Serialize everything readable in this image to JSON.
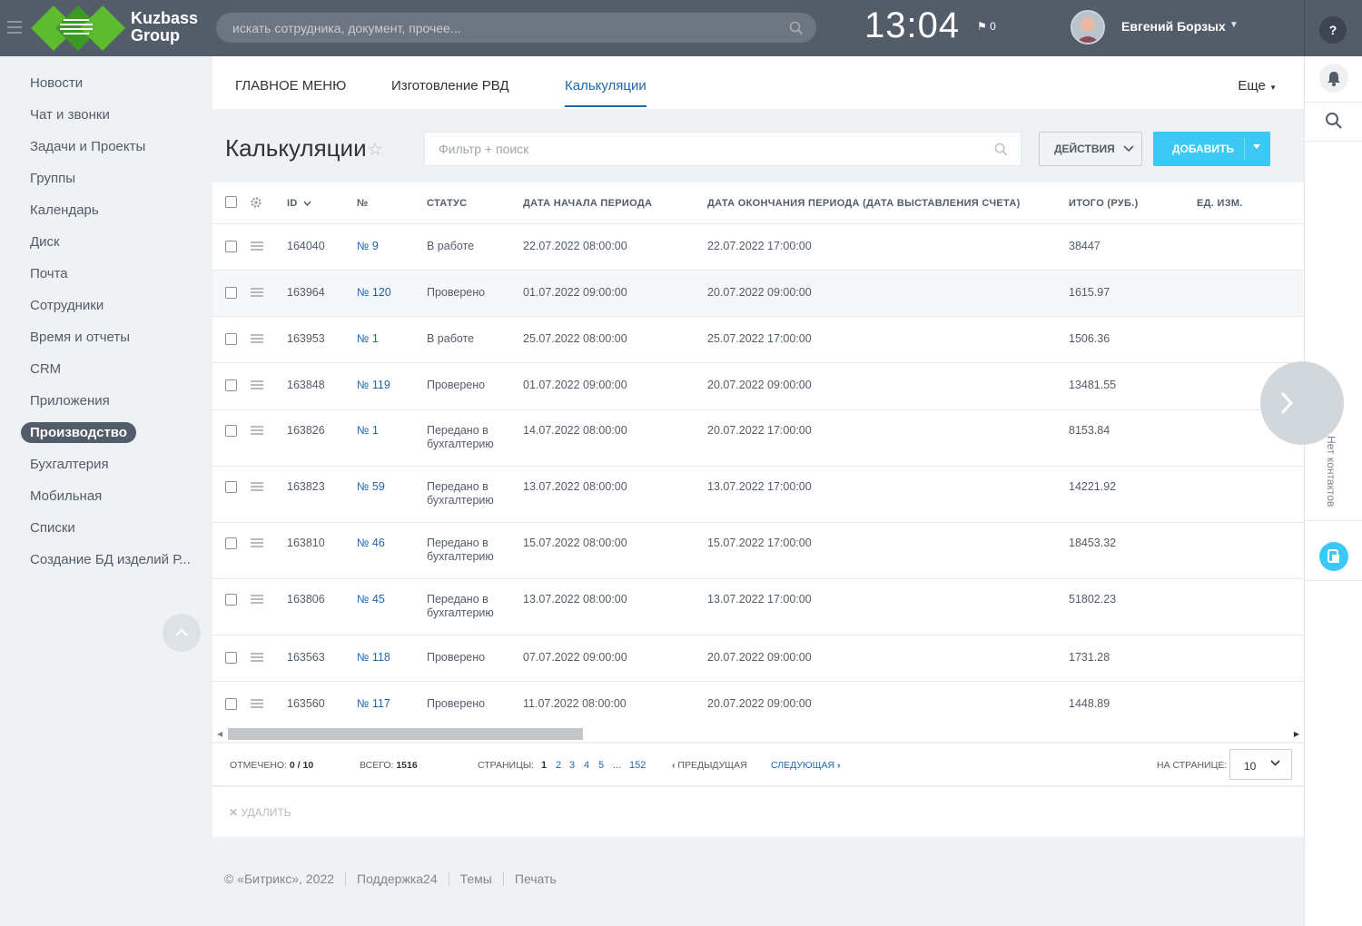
{
  "header": {
    "logo_line1": "Kuzbass",
    "logo_line2": "Group",
    "search_placeholder": "искать сотрудника, документ, прочее...",
    "clock": "13:04",
    "flag_count": "0",
    "user_name": "Евгений Борзых",
    "help_icon": "help-icon"
  },
  "sidebar": {
    "items": [
      {
        "label": "Новости"
      },
      {
        "label": "Чат и звонки"
      },
      {
        "label": "Задачи и Проекты"
      },
      {
        "label": "Группы"
      },
      {
        "label": "Календарь"
      },
      {
        "label": "Диск"
      },
      {
        "label": "Почта"
      },
      {
        "label": "Сотрудники"
      },
      {
        "label": "Время и отчеты"
      },
      {
        "label": "CRM"
      },
      {
        "label": "Приложения"
      },
      {
        "label": "Производство",
        "active": true
      },
      {
        "label": "Бухгалтерия"
      },
      {
        "label": "Мобильная"
      },
      {
        "label": "Списки"
      },
      {
        "label": "Создание БД изделий Р..."
      }
    ]
  },
  "tabs": {
    "items": [
      "ГЛАВНОЕ МЕНЮ",
      "Изготовление РВД",
      "Калькуляции"
    ],
    "active": "Калькуляции",
    "more": "Еще"
  },
  "toolbar": {
    "title": "Калькуляции",
    "filter_placeholder": "Фильтр + поиск",
    "actions_label": "действия",
    "add_label": "ДОБАВИТЬ"
  },
  "table": {
    "columns": [
      "ID",
      "№",
      "СТАТУС",
      "ДАТА НАЧАЛА ПЕРИОДА",
      "ДАТА ОКОНЧАНИЯ ПЕРИОДА (ДАТА ВЫСТАВЛЕНИЯ СЧЕТА)",
      "ИТОГО (РУБ.)",
      "ЕД. ИЗМ."
    ],
    "rows": [
      {
        "id": "164040",
        "num": "№ 9",
        "status": "В работе",
        "start": "22.07.2022 08:00:00",
        "end": "22.07.2022 17:00:00",
        "total": "38447"
      },
      {
        "id": "163964",
        "num": "№ 120",
        "status": "Проверено",
        "start": "01.07.2022 09:00:00",
        "end": "20.07.2022 09:00:00",
        "total": "1615.97"
      },
      {
        "id": "163953",
        "num": "№ 1",
        "status": "В работе",
        "start": "25.07.2022 08:00:00",
        "end": "25.07.2022 17:00:00",
        "total": "1506.36"
      },
      {
        "id": "163848",
        "num": "№ 119",
        "status": "Проверено",
        "start": "01.07.2022 09:00:00",
        "end": "20.07.2022 09:00:00",
        "total": "13481.55"
      },
      {
        "id": "163826",
        "num": "№ 1",
        "status": "Передано в бухгалтерию",
        "start": "14.07.2022 08:00:00",
        "end": "20.07.2022 17:00:00",
        "total": "8153.84"
      },
      {
        "id": "163823",
        "num": "№ 59",
        "status": "Передано в бухгалтерию",
        "start": "13.07.2022 08:00:00",
        "end": "13.07.2022 17:00:00",
        "total": "14221.92"
      },
      {
        "id": "163810",
        "num": "№ 46",
        "status": "Передано в бухгалтерию",
        "start": "15.07.2022 08:00:00",
        "end": "15.07.2022 17:00:00",
        "total": "18453.32"
      },
      {
        "id": "163806",
        "num": "№ 45",
        "status": "Передано в бухгалтерию",
        "start": "13.07.2022 08:00:00",
        "end": "13.07.2022 17:00:00",
        "total": "51802.23"
      },
      {
        "id": "163563",
        "num": "№ 118",
        "status": "Проверено",
        "start": "07.07.2022 09:00:00",
        "end": "20.07.2022 09:00:00",
        "total": "1731.28"
      },
      {
        "id": "163560",
        "num": "№ 117",
        "status": "Проверено",
        "start": "11.07.2022 08:00:00",
        "end": "20.07.2022 09:00:00",
        "total": "1448.89"
      }
    ]
  },
  "footer_bar": {
    "selected_label": "ОТМЕЧЕНО:",
    "selected_value": "0 / 10",
    "total_label": "ВСЕГО:",
    "total_value": "1516",
    "pages_label": "СТРАНИЦЫ:",
    "pages": [
      "1",
      "2",
      "3",
      "4",
      "5",
      "...",
      "152"
    ],
    "prev": "ПРЕДЫДУЩАЯ",
    "next": "СЛЕДУЮЩАЯ",
    "per_page_label": "НА СТРАНИЦЕ:",
    "per_page_value": "10"
  },
  "actions_bar": {
    "delete_label": "УДАЛИТЬ"
  },
  "right_panel": {
    "no_contacts": "Нет контактов"
  },
  "page_footer": {
    "links": [
      "© «Битрикс», 2022",
      "Поддержка24",
      "Темы",
      "Печать"
    ]
  },
  "colors": {
    "header_bg": "#535c69",
    "accent_blue": "#2067b0",
    "add_button": "#3bc8f5",
    "logo_green": "#3fae29"
  }
}
